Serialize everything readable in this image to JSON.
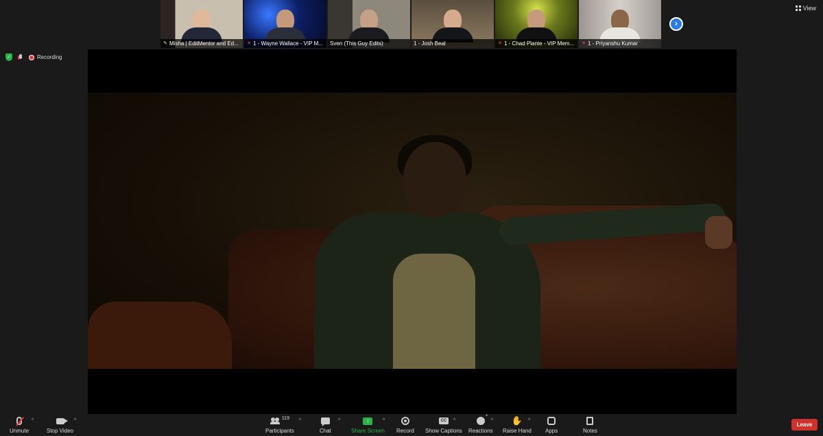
{
  "participants": [
    {
      "label": "Misha | EditMentor and Ed...",
      "icon": "pin-icon",
      "bg": "#8a6a4a"
    },
    {
      "label": "1 - Wayne Wallace - VIP M...",
      "icon": "mic-muted-icon",
      "bg": "#1d3d8a"
    },
    {
      "label": "Sven (This Guy Edits)",
      "icon": "",
      "bg": "#5a5550"
    },
    {
      "label": "1 - Josh Beal",
      "icon": "",
      "bg": "#6b5e4c"
    },
    {
      "label": "1 - Chad Plante - VIP Mem...",
      "icon": "mic-muted-icon",
      "bg": "#4a5a1a"
    },
    {
      "label": "1 - Priyanshu Kumar",
      "icon": "mic-muted-icon",
      "bg": "#7a7472"
    }
  ],
  "view": {
    "label": "View"
  },
  "status": {
    "recording_label": "Recording"
  },
  "toolbar": {
    "unmute": "Unmute",
    "stop_video": "Stop Video",
    "participants": "Participants",
    "participants_count": "119",
    "chat": "Chat",
    "share_screen": "Share Screen",
    "record": "Record",
    "show_captions": "Show Captions",
    "reactions": "Reactions",
    "raise_hand": "Raise Hand",
    "apps": "Apps",
    "notes": "Notes",
    "leave": "Leave",
    "cc_glyph": "CC",
    "share_glyph": "↑"
  },
  "colors": {
    "share_green": "#2ab346",
    "leave_red": "#d0312d",
    "active_speaker": "#3ccd52",
    "nav_blue": "#2a7de1"
  }
}
